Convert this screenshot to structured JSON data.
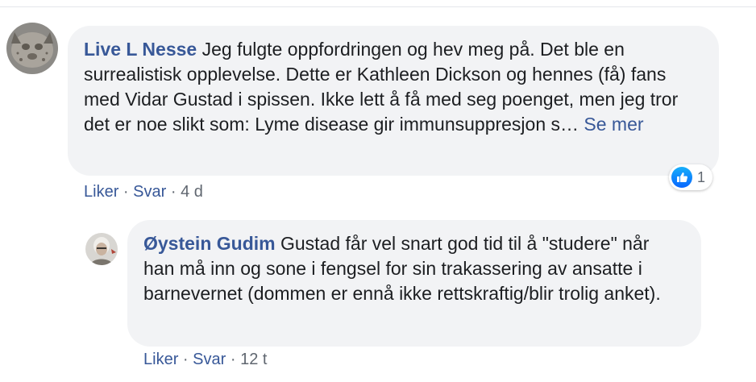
{
  "colors": {
    "link": "#385898",
    "bubble_bg": "#f2f3f5",
    "meta_text": "#606770",
    "like_blue": "#1877f2"
  },
  "main_comment": {
    "author": "Live L Nesse",
    "text": "Jeg fulgte oppfordringen og hev meg på. Det ble en surrealistisk opplevelse. Dette er Kathleen Dickson og hennes (få) fans med Vidar Gustad i spissen. Ikke lett å få med seg poenget, men jeg tror det er noe slikt som: Lyme disease gir immunsuppresjon s…",
    "see_more": "Se mer",
    "reaction_icon": "thumbs-up-icon",
    "reaction_count": "1",
    "like_label": "Liker",
    "separator": "·",
    "reply_label": "Svar",
    "timestamp": "4 d"
  },
  "reply_comment": {
    "author": "Øystein Gudim",
    "text": "Gustad får vel snart god tid til å \"studere\" når han må inn og sone i fengsel for sin trakassering av ansatte i barnevernet (dommen er ennå ikke rettskraftig/blir trolig anket).",
    "like_label": "Liker",
    "separator": "·",
    "reply_label": "Svar",
    "timestamp": "12 t"
  }
}
